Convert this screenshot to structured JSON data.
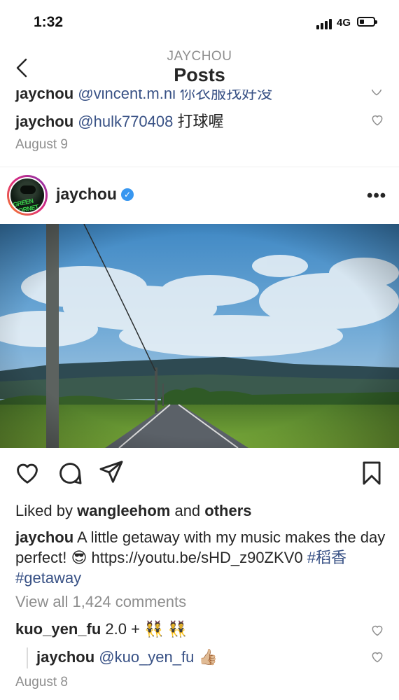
{
  "status_bar": {
    "time": "1:32",
    "network": "4G"
  },
  "nav": {
    "subtitle": "JAYCHOU",
    "title": "Posts"
  },
  "prev_comments": {
    "cut_user": "jaychou",
    "cut_text": "@vincent.m.ni 你衣服找好没",
    "comment_user": "jaychou",
    "comment_mention": "@hulk770408",
    "comment_text": "打球喔",
    "date": "August 9"
  },
  "post": {
    "username": "jaychou",
    "verified_mark": "✓",
    "more_label": "•••",
    "avatar_text": "GREEN HORNET",
    "liked_prefix": "Liked by",
    "liked_user": "wangleehom",
    "liked_and": "and",
    "liked_others": "others",
    "caption_user": "jaychou",
    "caption_text": "A little getaway with my music makes the day perfect! 😎 https://youtu.be/sHD_z90ZKV0",
    "caption_tag1": "#稻香",
    "caption_tag2": "#getaway",
    "view_all": "View all 1,424 comments",
    "comments": [
      {
        "user": "kuo_yen_fu",
        "text": "2.0 + 👯 👯"
      },
      {
        "user": "jaychou",
        "mention": "@kuo_yen_fu",
        "text": "👍🏼"
      }
    ],
    "date": "August 8"
  },
  "icons": [
    "back-chevron",
    "heart-outline",
    "comment-bubble",
    "share-paper-plane",
    "bookmark-outline",
    "verified-badge",
    "more-dots"
  ]
}
